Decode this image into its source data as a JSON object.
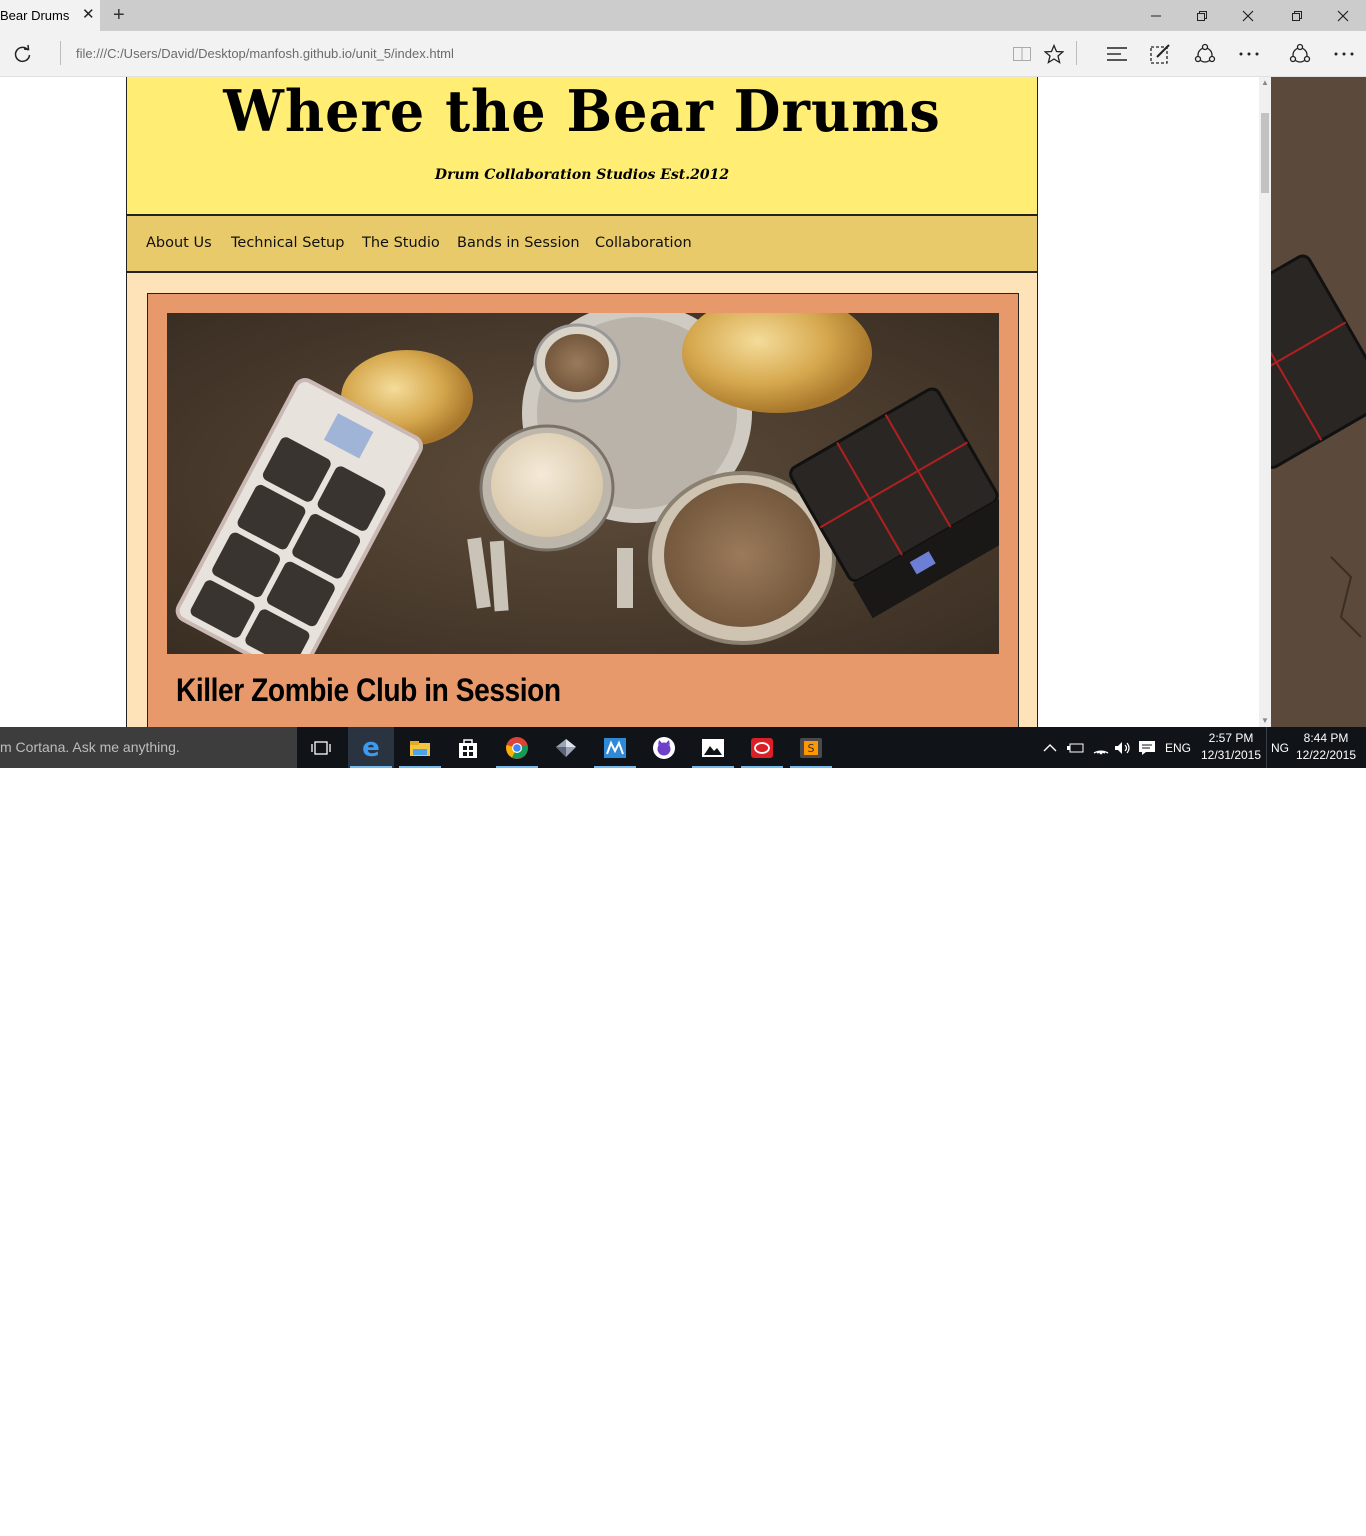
{
  "browser": {
    "tab_title": "Bear Drums",
    "url": "file:///C:/Users/David/Desktop/manfosh.github.io/unit_5/index.html"
  },
  "site": {
    "title": "Where the Bear Drums",
    "subtitle": "Drum Collaboration Studios Est.2012",
    "nav": [
      "About Us",
      "Technical Setup",
      "The Studio",
      "Bands in Session",
      "Collaboration"
    ],
    "article_title": "Killer Zombie Club in Session"
  },
  "taskbar": {
    "search_text": "m Cortana. Ask me anything.",
    "language": "ENG",
    "language_secondary": "NG",
    "time": "2:57 PM",
    "date": "12/31/2015",
    "time_secondary": "8:44 PM",
    "date_secondary": "12/22/2015"
  },
  "colors": {
    "header_bg": "#ffee73",
    "nav_bg": "#e9ca6a",
    "page_bg": "#ffe3b8",
    "article_bg": "#e8996b"
  }
}
